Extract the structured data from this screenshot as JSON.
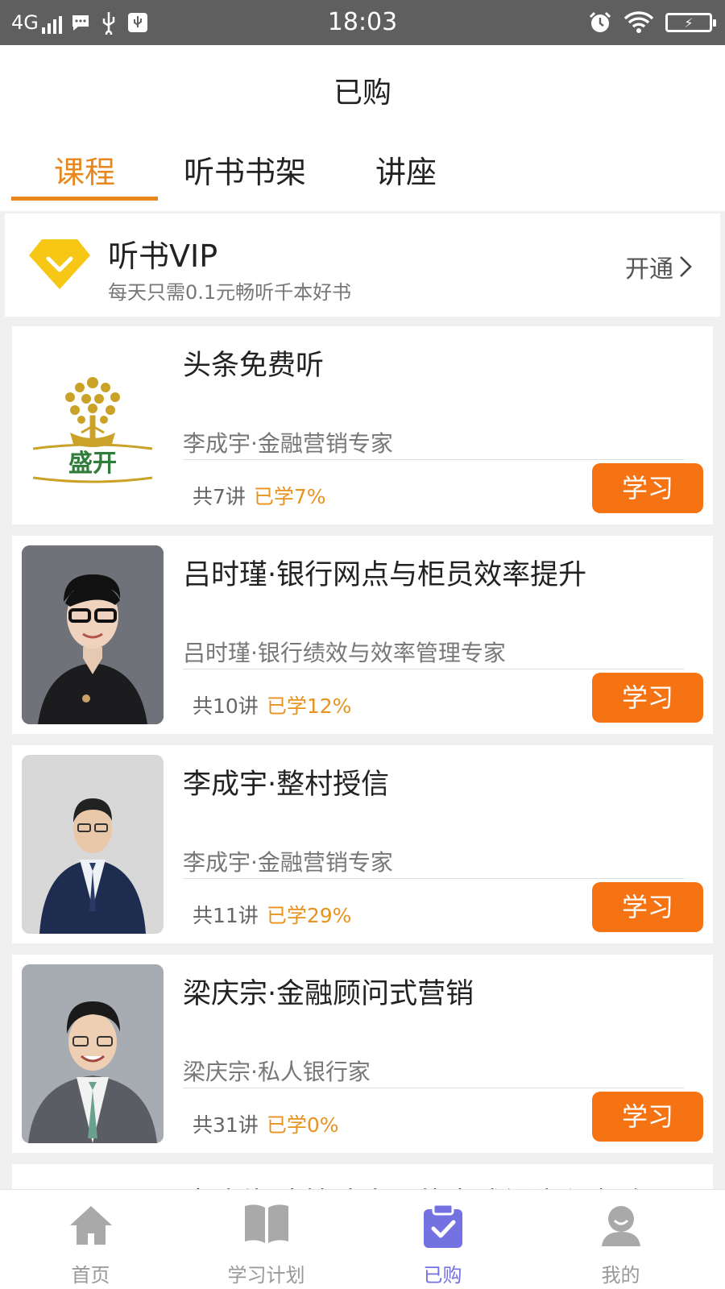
{
  "status_bar": {
    "network": "4G",
    "time": "18:03"
  },
  "header": {
    "title": "已购",
    "tabs": [
      {
        "label": "课程",
        "active": true
      },
      {
        "label": "听书书架",
        "active": false
      },
      {
        "label": "讲座",
        "active": false
      }
    ]
  },
  "vip": {
    "title": "听书VIP",
    "subtitle": "每天只需0.1元畅听千本好书",
    "action": "开通",
    "icon": "diamond-icon"
  },
  "courses": [
    {
      "title": "头条免费听",
      "author": "李成宇·金融营销专家",
      "count": "共7讲",
      "progress": "已学7%",
      "button": "学习",
      "thumb": "shengkai-logo",
      "logo_text": "盛开"
    },
    {
      "title": "吕时瑾·银行网点与柜员效率提升",
      "author": "吕时瑾·银行绩效与效率管理专家",
      "count": "共10讲",
      "progress": "已学12%",
      "button": "学习",
      "thumb": "portrait-woman"
    },
    {
      "title": "李成宇·整村授信",
      "author": "李成宇·金融营销专家",
      "count": "共11讲",
      "progress": "已学29%",
      "button": "学习",
      "thumb": "portrait-man"
    },
    {
      "title": "梁庆宗·金融顾问式营销",
      "author": "梁庆宗·私人银行家",
      "count": "共31讲",
      "progress": "已学0%",
      "button": "学习",
      "thumb": "portrait-man"
    },
    {
      "title": "唐建伟·疫情冲击下的全球经济和金融"
    }
  ],
  "bottom_nav": [
    {
      "label": "首页",
      "icon": "home-icon",
      "active": false
    },
    {
      "label": "学习计划",
      "icon": "book-icon",
      "active": false
    },
    {
      "label": "已购",
      "icon": "clipboard-check-icon",
      "active": true
    },
    {
      "label": "我的",
      "icon": "user-icon",
      "active": false
    }
  ],
  "colors": {
    "accent": "#e8871e",
    "button": "#f57313",
    "nav_active": "#7471e0",
    "vip_yellow": "#f6c714"
  }
}
